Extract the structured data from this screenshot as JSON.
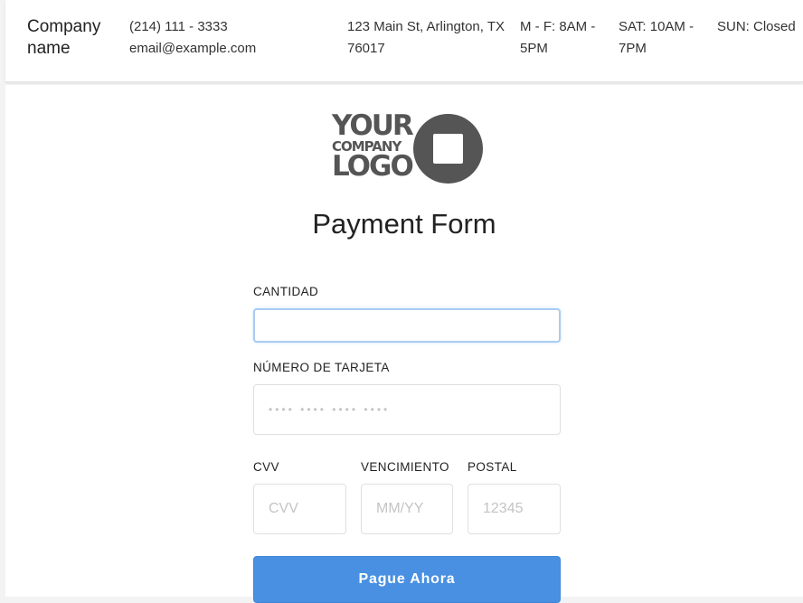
{
  "header": {
    "company_name": "Company name",
    "phone": "(214) 111 - 3333",
    "email": "email@example.com",
    "address": "123 Main St, Arlington, TX 76017",
    "hours_weekday": "M - F: 8AM - 5PM",
    "hours_saturday": "SAT: 10AM - 7PM",
    "hours_sunday": "SUN: Closed"
  },
  "logo": {
    "line1": "YOUR",
    "line2": "COMPANY",
    "line3": "LOGO",
    "color": "#555555"
  },
  "form": {
    "title": "Payment Form",
    "amount": {
      "label": "CANTIDAD",
      "value": "",
      "placeholder": ""
    },
    "card_number": {
      "label": "NÚMERO DE TARJETA",
      "value": "",
      "placeholder": "•••• •••• •••• ••••"
    },
    "cvv": {
      "label": "CVV",
      "value": "",
      "placeholder": "CVV"
    },
    "expiry": {
      "label": "VENCIMIENTO",
      "value": "",
      "placeholder": "MM/YY"
    },
    "postal": {
      "label": "POSTAL",
      "value": "",
      "placeholder": "12345"
    },
    "submit_label": "Pague Ahora"
  },
  "colors": {
    "button": "#4a90e2",
    "focus_border": "#a8ccf2"
  }
}
